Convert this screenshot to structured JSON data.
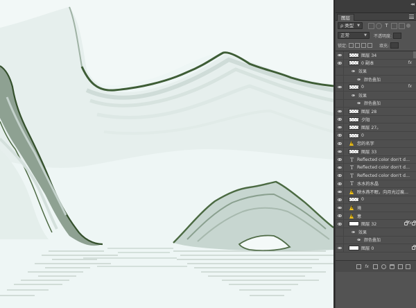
{
  "panel": {
    "tab_label": "图层",
    "collapse_glyph": "◂◂",
    "filter_select": {
      "glyph": "ρ",
      "value": "类型"
    },
    "blend_mode": "正常",
    "opacity_label": "不透明度:",
    "lock_label": "锁定:",
    "fill_label": "填充:"
  },
  "layers": [
    {
      "kind": "image",
      "thumb": "checker",
      "name": "图层 34"
    },
    {
      "kind": "image",
      "thumb": "checker",
      "name": "0 副本",
      "fx": "fx",
      "indent": true
    },
    {
      "kind": "effects",
      "name": "效果"
    },
    {
      "kind": "effect",
      "name": "颜色叠加"
    },
    {
      "kind": "image",
      "thumb": "checker",
      "name": "0",
      "fx": "fx",
      "indent": true
    },
    {
      "kind": "effects",
      "name": "效果"
    },
    {
      "kind": "effect",
      "name": "颜色叠加"
    },
    {
      "kind": "image",
      "thumb": "checker",
      "name": "图层 28"
    },
    {
      "kind": "image",
      "thumb": "checker",
      "name": "夕阳",
      "indent": true
    },
    {
      "kind": "image",
      "thumb": "checker",
      "name": "图层 27。"
    },
    {
      "kind": "image",
      "thumb": "checker",
      "name": "0"
    },
    {
      "kind": "warn",
      "name": "您的名字"
    },
    {
      "kind": "image",
      "thumb": "checker",
      "name": "图层 33"
    },
    {
      "kind": "text",
      "glyph": "T",
      "name": "Reflected color don't don't, t..."
    },
    {
      "kind": "text",
      "glyph": "T",
      "name": "Reflected color don't don't, t..."
    },
    {
      "kind": "text",
      "glyph": "T",
      "name": "Reflected color don't don't, t..."
    },
    {
      "kind": "text",
      "glyph": "T",
      "name": "水水的水晶"
    },
    {
      "kind": "warn",
      "name": "映水燕不眠，向月光过痕..."
    },
    {
      "kind": "image",
      "thumb": "checker",
      "name": "0"
    },
    {
      "kind": "warn",
      "name": "境"
    },
    {
      "kind": "warn",
      "name": "意"
    },
    {
      "kind": "image",
      "thumb": "white",
      "name": "图层 32",
      "fx": "fx",
      "locks": 2
    },
    {
      "kind": "effects",
      "name": "效果"
    },
    {
      "kind": "effect",
      "name": "颜色叠加"
    },
    {
      "kind": "image",
      "thumb": "white",
      "name": "图层 0",
      "locks": 1
    }
  ],
  "bottom_icons": [
    "link-icon",
    "fx-icon",
    "mask-icon",
    "adjustment-icon",
    "folder-icon",
    "new-layer-icon",
    "trash-icon"
  ],
  "colors": {
    "canvas_bg": "#eef5f4",
    "ink_dark": "#3c5a33",
    "ink_mid": "#8fa293",
    "panel_bg": "#535353"
  }
}
